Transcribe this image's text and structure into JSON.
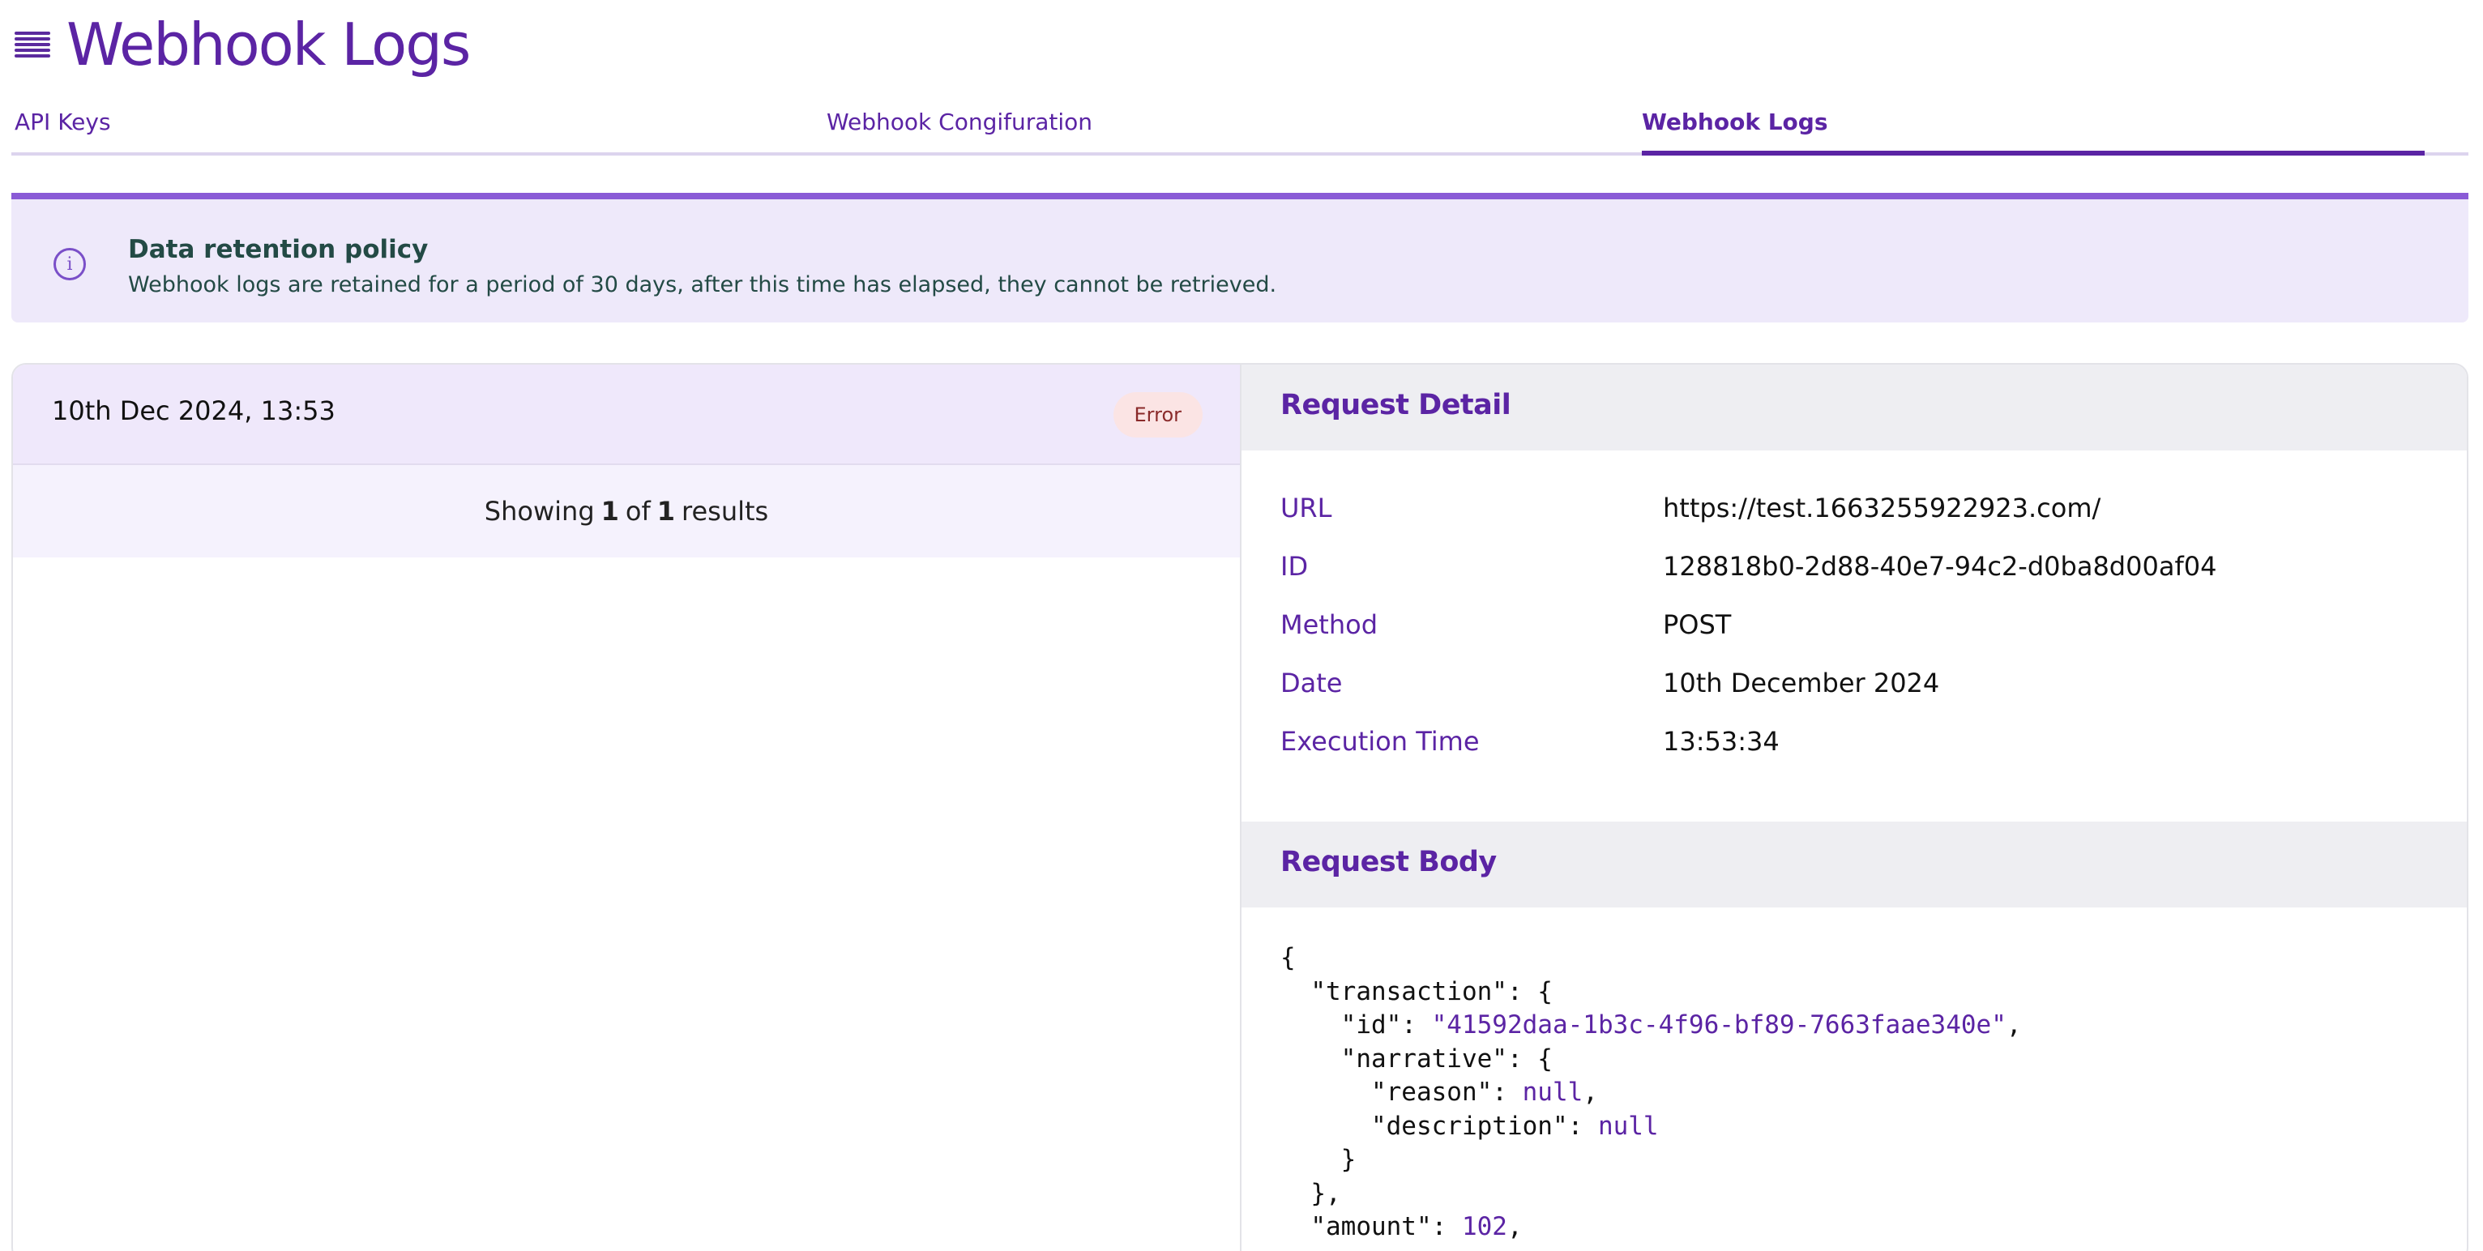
{
  "header": {
    "title": "Webhook Logs",
    "menu_icon": "menu-lines-icon"
  },
  "tabs": [
    {
      "label": "API Keys",
      "active": false
    },
    {
      "label": "Webhook Congifuration",
      "active": false
    },
    {
      "label": "Webhook Logs",
      "active": true
    }
  ],
  "alert": {
    "icon": "info-icon",
    "title": "Data retention policy",
    "text": "Webhook logs are retained for a period of 30 days, after this time has elapsed, they cannot be retrieved."
  },
  "log_list": {
    "items": [
      {
        "date": "10th Dec 2024, 13:53",
        "status": "Error"
      }
    ],
    "results": {
      "prefix": "Showing",
      "current": "1",
      "of_word": "of",
      "total": "1",
      "suffix": "results"
    }
  },
  "request_detail": {
    "title": "Request Detail",
    "rows": [
      {
        "label": "URL",
        "value": "https://test.1663255922923.com/"
      },
      {
        "label": "ID",
        "value": "128818b0-2d88-40e7-94c2-d0ba8d00af04"
      },
      {
        "label": "Method",
        "value": "POST"
      },
      {
        "label": "Date",
        "value": "10th December 2024"
      },
      {
        "label": "Execution Time",
        "value": "13:53:34"
      }
    ]
  },
  "request_body": {
    "title": "Request Body",
    "transaction_id": "\"41592daa-1b3c-4f96-bf89-7663faae340e\"",
    "reason": "null",
    "description": "null",
    "amount": "102"
  },
  "colors": {
    "accent": "#5b24a4",
    "alert_bg": "#eee9fa",
    "alert_border": "#8a5bd6",
    "error_badge_bg": "#fbe4e4"
  }
}
